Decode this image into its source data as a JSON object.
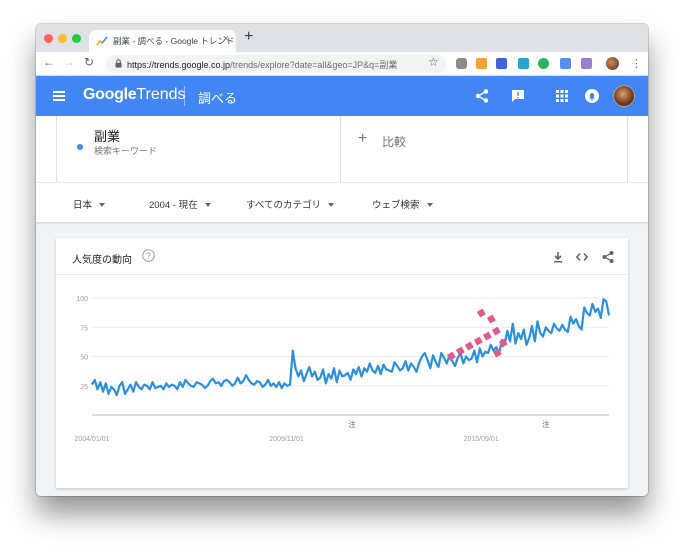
{
  "browser": {
    "tab_title": "副業 - 調べる - Google トレンド",
    "tab_close": "×",
    "new_tab": "+",
    "url_host": "https://trends.google.co.jp",
    "url_path": "/trends/explore?date=all&geo=JP&q=副業",
    "star_icon": "☆",
    "menu_icon": "⋮"
  },
  "header": {
    "brand": "Google",
    "product": "Trends",
    "page": "調べる",
    "color": "#4285f4"
  },
  "search": {
    "term": "副業",
    "term_sub": "検索キーワード",
    "term_color": "#4285f4",
    "compare_plus": "+",
    "compare_label": "比較"
  },
  "filters": {
    "region": "日本",
    "period": "2004 - 現在",
    "category": "すべてのカテゴリ",
    "property": "ウェブ検索"
  },
  "card": {
    "title": "人気度の動向"
  },
  "chart_data": {
    "type": "line",
    "title": "",
    "xlabel": "",
    "ylabel": "",
    "ylim": [
      0,
      100
    ],
    "yticks": [
      25,
      50,
      75,
      100
    ],
    "ytick_labels": [
      "25",
      "50",
      "75",
      "100"
    ],
    "xtick_labels": [
      "2004/01/01",
      "2009/11/01",
      "2015/09/01"
    ],
    "notes": [
      "注",
      "注"
    ],
    "grid": true,
    "line_color": "#2b8fe0",
    "annotation_arrow_color": "#e2598b",
    "series": [
      {
        "values": [
          26,
          30,
          22,
          28,
          20,
          27,
          18,
          24,
          22,
          17,
          25,
          28,
          18,
          22,
          26,
          20,
          28,
          24,
          22,
          26,
          25,
          22,
          28,
          23,
          24,
          25,
          22,
          27,
          24,
          26,
          25,
          22,
          28,
          24,
          30,
          27,
          25,
          24,
          28,
          27,
          26,
          23,
          25,
          29,
          31,
          27,
          28,
          25,
          29,
          30,
          28,
          25,
          27,
          32,
          27,
          29,
          34,
          30,
          27,
          26,
          29,
          28,
          24,
          26,
          30,
          25,
          27,
          24,
          28,
          23,
          27,
          25,
          26,
          55,
          40,
          33,
          38,
          29,
          35,
          41,
          33,
          37,
          30,
          32,
          39,
          27,
          35,
          31,
          40,
          28,
          38,
          33,
          34,
          36,
          30,
          39,
          35,
          41,
          33,
          40,
          37,
          44,
          38,
          36,
          42,
          35,
          43,
          39,
          38,
          37,
          45,
          42,
          38,
          40,
          46,
          38,
          44,
          41,
          37,
          45,
          50,
          53,
          47,
          40,
          51,
          45,
          41,
          53,
          49,
          44,
          51,
          46,
          42,
          49,
          53,
          44,
          50,
          47,
          48,
          55,
          45,
          57,
          50,
          54,
          53,
          60,
          55,
          58,
          52,
          64,
          60,
          72,
          63,
          78,
          61,
          70,
          65,
          73,
          60,
          66,
          76,
          63,
          80,
          70,
          67,
          75,
          72,
          70,
          78,
          74,
          72,
          77,
          73,
          71,
          84,
          78,
          82,
          76,
          73,
          92,
          87,
          85,
          95,
          88,
          91,
          83,
          99,
          97,
          85
        ]
      }
    ]
  }
}
